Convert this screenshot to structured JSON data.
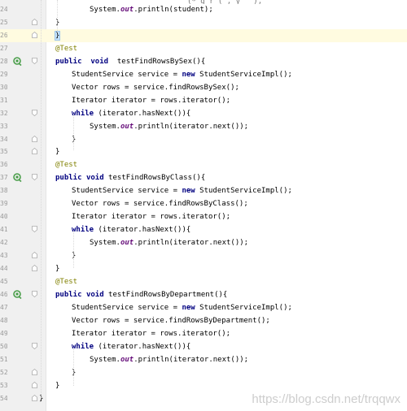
{
  "editor": {
    "top_fragment": "(* g   r     (   , y        _    ),",
    "watermark": "https://blog.csdn.net/trqqwx",
    "lines": [
      {
        "num": "24",
        "text": "System.out.println(student);",
        "fold": false,
        "run": false
      },
      {
        "num": "25",
        "text": "}",
        "fold": true,
        "run": false
      },
      {
        "num": "26",
        "text": "}",
        "fold": true,
        "run": false
      },
      {
        "num": "27",
        "text": "@Test",
        "fold": false,
        "run": false
      },
      {
        "num": "28",
        "text": "public  void  testFindRowsBySex(){",
        "fold": true,
        "run": true
      },
      {
        "num": "29",
        "text": "StudentService service = new StudentServiceImpl();",
        "fold": false,
        "run": false
      },
      {
        "num": "30",
        "text": "Vector rows = service.findRowsBySex();",
        "fold": false,
        "run": false
      },
      {
        "num": "31",
        "text": "Iterator iterator = rows.iterator();",
        "fold": false,
        "run": false
      },
      {
        "num": "32",
        "text": "while (iterator.hasNext()){",
        "fold": true,
        "run": false
      },
      {
        "num": "33",
        "text": "System.out.println(iterator.next());",
        "fold": false,
        "run": false
      },
      {
        "num": "34",
        "text": "}",
        "fold": true,
        "run": false
      },
      {
        "num": "35",
        "text": "}",
        "fold": true,
        "run": false
      },
      {
        "num": "36",
        "text": "@Test",
        "fold": false,
        "run": false
      },
      {
        "num": "37",
        "text": "public void testFindRowsByClass(){",
        "fold": true,
        "run": true
      },
      {
        "num": "38",
        "text": "StudentService service = new StudentServiceImpl();",
        "fold": false,
        "run": false
      },
      {
        "num": "39",
        "text": "Vector rows = service.findRowsByClass();",
        "fold": false,
        "run": false
      },
      {
        "num": "40",
        "text": "Iterator iterator = rows.iterator();",
        "fold": false,
        "run": false
      },
      {
        "num": "41",
        "text": "while (iterator.hasNext()){",
        "fold": true,
        "run": false
      },
      {
        "num": "42",
        "text": "System.out.println(iterator.next());",
        "fold": false,
        "run": false
      },
      {
        "num": "43",
        "text": "}",
        "fold": true,
        "run": false
      },
      {
        "num": "44",
        "text": "}",
        "fold": true,
        "run": false
      },
      {
        "num": "45",
        "text": "@Test",
        "fold": false,
        "run": false
      },
      {
        "num": "46",
        "text": "public void testFindRowsByDepartment(){",
        "fold": true,
        "run": true
      },
      {
        "num": "47",
        "text": "StudentService service = new StudentServiceImpl();",
        "fold": false,
        "run": false
      },
      {
        "num": "48",
        "text": "Vector rows = service.findRowsByDepartment();",
        "fold": false,
        "run": false
      },
      {
        "num": "49",
        "text": "Iterator iterator = rows.iterator();",
        "fold": false,
        "run": false
      },
      {
        "num": "50",
        "text": "while (iterator.hasNext()){",
        "fold": true,
        "run": false
      },
      {
        "num": "51",
        "text": "System.out.println(iterator.next());",
        "fold": false,
        "run": false
      },
      {
        "num": "52",
        "text": "}",
        "fold": true,
        "run": false
      },
      {
        "num": "53",
        "text": "}",
        "fold": true,
        "run": false
      },
      {
        "num": "54",
        "text": "}",
        "fold": true,
        "run": false
      }
    ]
  }
}
